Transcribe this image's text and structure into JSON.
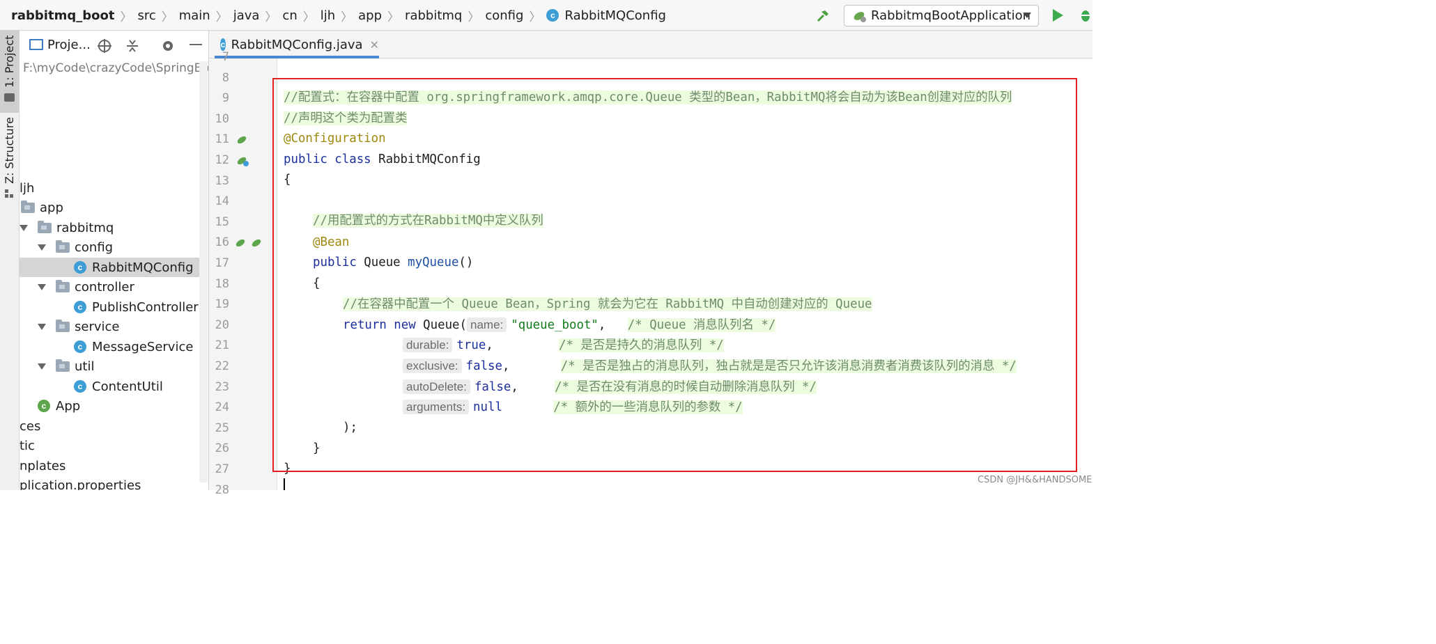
{
  "breadcrumbs": [
    "rabbitmq_boot",
    "src",
    "main",
    "java",
    "cn",
    "ljh",
    "app",
    "rabbitmq",
    "config",
    "RabbitMQConfig"
  ],
  "toolbar": {
    "run_config": "RabbitmqBootApplication"
  },
  "tool_strip": {
    "project_tab": "1: Project",
    "structure_tab": "Z: Structure"
  },
  "project_panel": {
    "title": "Proje...",
    "path": "F:\\myCode\\crazyCode\\SpringBoo",
    "tree": [
      {
        "label": "ljh",
        "indent": 0,
        "type": "none"
      },
      {
        "label": "app",
        "indent": 1,
        "type": "folder"
      },
      {
        "label": "rabbitmq",
        "indent": 1,
        "type": "folder-open"
      },
      {
        "label": "config",
        "indent": 2,
        "type": "folder-open"
      },
      {
        "label": "RabbitMQConfig",
        "indent": 3,
        "type": "class",
        "selected": true
      },
      {
        "label": "controller",
        "indent": 2,
        "type": "folder-open"
      },
      {
        "label": "PublishController",
        "indent": 3,
        "type": "class"
      },
      {
        "label": "service",
        "indent": 2,
        "type": "folder-open"
      },
      {
        "label": "MessageService",
        "indent": 3,
        "type": "class"
      },
      {
        "label": "util",
        "indent": 2,
        "type": "folder-open"
      },
      {
        "label": "ContentUtil",
        "indent": 3,
        "type": "class"
      },
      {
        "label": "App",
        "indent": 1,
        "type": "app"
      },
      {
        "label": "ces",
        "indent": 0,
        "type": "none"
      },
      {
        "label": "tic",
        "indent": 0,
        "type": "none"
      },
      {
        "label": "nplates",
        "indent": 0,
        "type": "none"
      },
      {
        "label": "plication.properties",
        "indent": 0,
        "type": "none"
      }
    ]
  },
  "editor": {
    "tab": "RabbitMQConfig.java",
    "line_numbers": [
      "7",
      "8",
      "9",
      "10",
      "11",
      "12",
      "13",
      "14",
      "15",
      "16",
      "17",
      "18",
      "19",
      "20",
      "21",
      "22",
      "23",
      "24",
      "25",
      "26",
      "27",
      "28"
    ],
    "lines": {
      "l9": "//配置式：在容器中配置 org.springframework.amqp.core.Queue 类型的Bean，RabbitMQ将会自动为该Bean创建对应的队列",
      "l10": "//声明这个类为配置类",
      "l11": "@Configuration",
      "l12_kw": "public class",
      "l12_name": " RabbitMQConfig",
      "l13": "{",
      "l15": "//用配置式的方式在RabbitMQ中定义队列",
      "l16": "@Bean",
      "l17_kw": "public",
      "l17_type": " Queue ",
      "l17_fn": "myQueue",
      "l17_end": "()",
      "l18": "{",
      "l19": "//在容器中配置一个 Queue Bean，Spring 就会为它在 RabbitMQ 中自动创建对应的 Queue",
      "l20_kw": "return new",
      "l20_type": " Queue(",
      "l20_hint": "name:",
      "l20_str": "\"queue_boot\"",
      "l20_end": ",   ",
      "l20_cmt": "/* Queue 消息队列名 */",
      "l21_hint": "durable:",
      "l21_val": "true",
      "l21_end": ",         ",
      "l21_cmt": "/* 是否是持久的消息队列 */",
      "l22_hint": "exclusive:",
      "l22_val": "false",
      "l22_end": ",       ",
      "l22_cmt": "/* 是否是独占的消息队列，独占就是是否只允许该消息消费者消费该队列的消息 */",
      "l23_hint": "autoDelete:",
      "l23_val": "false",
      "l23_end": ",     ",
      "l23_cmt": "/* 是否在没有消息的时候自动删除消息队列 */",
      "l24_hint": "arguments:",
      "l24_val": "null",
      "l24_end": "       ",
      "l24_cmt": "/* 额外的一些消息队列的参数 */",
      "l25": ");",
      "l26": "}",
      "l27": "}"
    }
  },
  "watermark": "CSDN @JH&&HANDSOME"
}
